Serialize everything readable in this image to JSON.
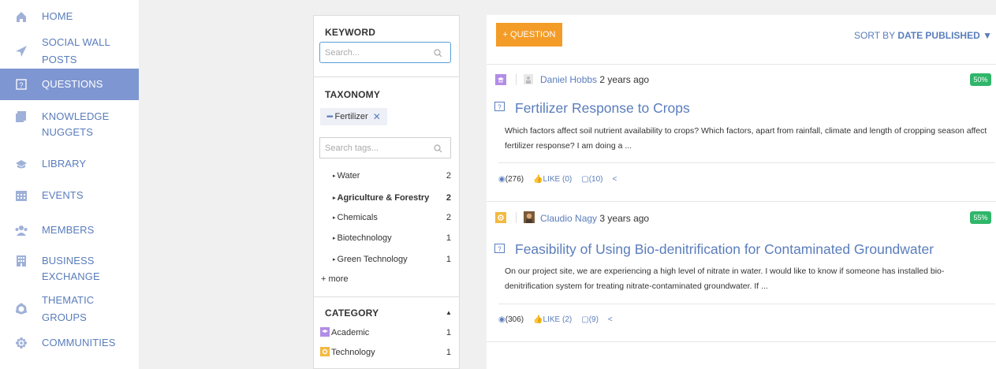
{
  "sidebar": {
    "items": [
      {
        "label": "HOME",
        "icon": "home-icon"
      },
      {
        "label": "SOCIAL WALL POSTS",
        "icon": "paper-plane-icon"
      },
      {
        "label": "QUESTIONS",
        "icon": "question-icon"
      },
      {
        "label_line1": "KNOWLEDGE",
        "label_line2": "NUGGETS",
        "icon": "nugget-icon"
      },
      {
        "label": "LIBRARY",
        "icon": "library-icon"
      },
      {
        "label": "EVENTS",
        "icon": "calendar-icon"
      },
      {
        "label": "MEMBERS",
        "icon": "members-icon"
      },
      {
        "label_line1": "BUSINESS",
        "label_line2": "EXCHANGE",
        "icon": "business-icon"
      },
      {
        "label": "THEMATIC GROUPS",
        "icon": "groups-icon"
      },
      {
        "label": "COMMUNITIES",
        "icon": "communities-icon"
      }
    ]
  },
  "filter": {
    "keyword_title": "KEYWORD",
    "keyword_placeholder": "Search...",
    "taxonomy_title": "TAXONOMY",
    "active_tag": "Fertilizer",
    "tags_placeholder": "Search tags...",
    "tags": [
      {
        "label": "Water",
        "count": "2"
      },
      {
        "label": "Agriculture & Forestry",
        "count": "2"
      },
      {
        "label": "Chemicals",
        "count": "2"
      },
      {
        "label": "Biotechnology",
        "count": "1"
      },
      {
        "label": "Green Technology",
        "count": "1"
      }
    ],
    "more": "+ more",
    "category_title": "CATEGORY",
    "categories": [
      {
        "label": "Academic",
        "count": "1",
        "color": "#b28de6"
      },
      {
        "label": "Technology",
        "count": "1",
        "color": "#f4b940"
      }
    ]
  },
  "toolbar": {
    "add_question": "+ QUESTION",
    "sort_prefix": "SORT BY",
    "sort_value": "DATE PUBLISHED"
  },
  "questions": [
    {
      "author": "Daniel Hobbs",
      "time": "2 years ago",
      "percent": "50%",
      "title": "Fertilizer Response to Crops",
      "body": "Which factors affect soil nutrient availability to crops?  Which factors, apart from rainfall, climate and length of cropping season affect fertilizer response?  I am doing a ...",
      "views": "(276)",
      "likes": "LIKE (0)",
      "comments": "(10)",
      "category_color": "#b28de6"
    },
    {
      "author": "Claudio Nagy",
      "time": "3 years ago",
      "percent": "55%",
      "title": "Feasibility of Using Bio-denitrification for Contaminated Groundwater",
      "body": "On our project site, we are experiencing a high level of nitrate in water. I would like to know if someone has installed bio-denitrification system for treating nitrate-contaminated groundwater.  If ...",
      "views": "(306)",
      "likes": "LIKE (2)",
      "comments": "(9)",
      "category_color": "#f4b940"
    }
  ],
  "colors": {
    "accent": "#5a7dbc",
    "active_nav": "#7e96d1",
    "orange": "#f39c28",
    "green": "#2fb66a"
  }
}
